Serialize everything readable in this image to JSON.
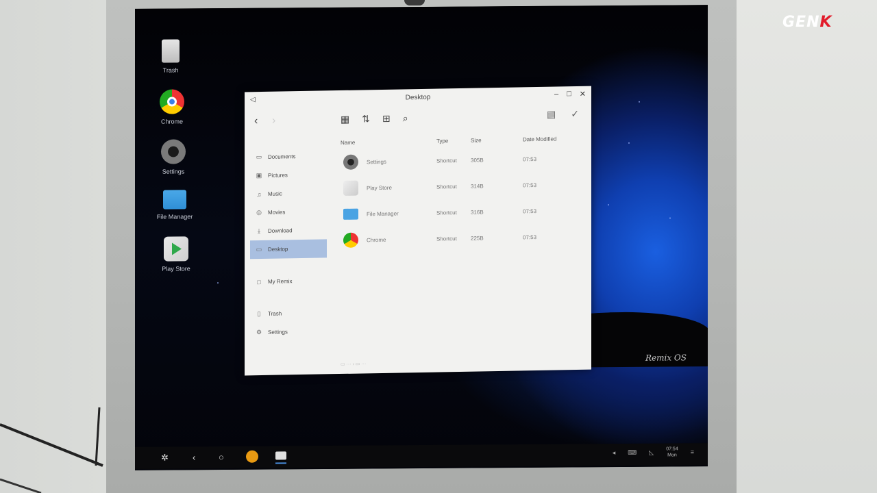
{
  "brand": {
    "text": "GENK"
  },
  "desktop_icons": [
    {
      "label": "Trash",
      "icon": "trash-icon"
    },
    {
      "label": "Chrome",
      "icon": "chrome-icon"
    },
    {
      "label": "Settings",
      "icon": "settings-icon"
    },
    {
      "label": "File Manager",
      "icon": "folder-icon"
    },
    {
      "label": "Play Store",
      "icon": "play-store-icon"
    }
  ],
  "window": {
    "title": "Desktop",
    "sidebar": {
      "groups": [
        {
          "items": [
            {
              "label": "Documents",
              "icon": "folder-icon"
            },
            {
              "label": "Pictures",
              "icon": "image-icon"
            },
            {
              "label": "Music",
              "icon": "music-icon"
            },
            {
              "label": "Movies",
              "icon": "movie-icon"
            },
            {
              "label": "Download",
              "icon": "download-icon"
            },
            {
              "label": "Desktop",
              "icon": "desktop-icon",
              "active": true
            }
          ]
        },
        {
          "items": [
            {
              "label": "My Remix",
              "icon": "device-icon"
            }
          ]
        },
        {
          "items": [
            {
              "label": "Trash",
              "icon": "trash-icon"
            },
            {
              "label": "Settings",
              "icon": "gear-icon"
            }
          ]
        }
      ]
    },
    "columns": {
      "name": "Name",
      "type": "Type",
      "size": "Size",
      "date": "Date Modified"
    },
    "files": [
      {
        "name": "Settings",
        "type": "Shortcut",
        "size": "305B",
        "date": "07:53",
        "icon": "settings-icon"
      },
      {
        "name": "Play Store",
        "type": "Shortcut",
        "size": "314B",
        "date": "07:53",
        "icon": "play-store-icon"
      },
      {
        "name": "File Manager",
        "type": "Shortcut",
        "size": "316B",
        "date": "07:53",
        "icon": "folder-icon"
      },
      {
        "name": "Chrome",
        "type": "Shortcut",
        "size": "225B",
        "date": "07:53",
        "icon": "chrome-icon"
      }
    ]
  },
  "wallpaper_brand": "Remix OS",
  "taskbar": {
    "clock_time": "07:54",
    "clock_day": "Mon"
  },
  "colors": {
    "sidebar_active": "#a9bfe0",
    "taskbar": "#0a0a0c",
    "brand_red": "#e21b2a"
  }
}
